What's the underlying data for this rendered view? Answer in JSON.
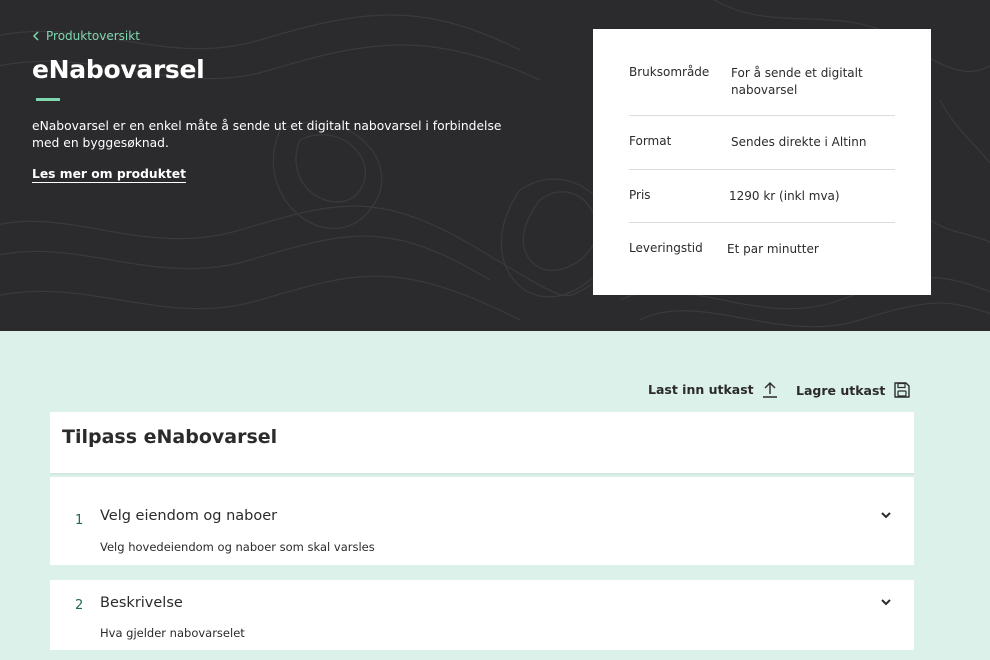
{
  "hero": {
    "back_link": "Produktoversikt",
    "title": "eNabovarsel",
    "lead": "eNabovarsel er en enkel måte å sende ut et digitalt nabovarsel i forbindelse med en byggesøknad.",
    "read_more": "Les mer om produktet"
  },
  "info": [
    {
      "label": "Bruksområde",
      "value": "For å sende et digitalt nabovarsel"
    },
    {
      "label": "Format",
      "value": "Sendes direkte i Altinn"
    },
    {
      "label": "Pris",
      "value": "1290 kr (inkl mva)"
    },
    {
      "label": "Leveringstid",
      "value": "Et par minutter"
    }
  ],
  "actions": {
    "load_label": "Last inn utkast",
    "save_label": "Lagre utkast"
  },
  "panel": {
    "title": "Tilpass eNabovarsel"
  },
  "steps": [
    {
      "number": "1",
      "title": "Velg eiendom og naboer",
      "subtitle": "Velg hovedeiendom og naboer som skal varsles"
    },
    {
      "number": "2",
      "title": "Beskrivelse",
      "subtitle": "Hva gjelder nabovarselet"
    }
  ],
  "colors": {
    "hero_bg": "#2b2b2d",
    "accent": "#7fd7b0",
    "page_bg": "#dcf1e9",
    "step_number": "#1f6b52"
  },
  "icons": {
    "back": "chevron-left-icon",
    "load": "upload-icon",
    "save": "floppy-disk-icon",
    "expand": "chevron-down-icon"
  }
}
